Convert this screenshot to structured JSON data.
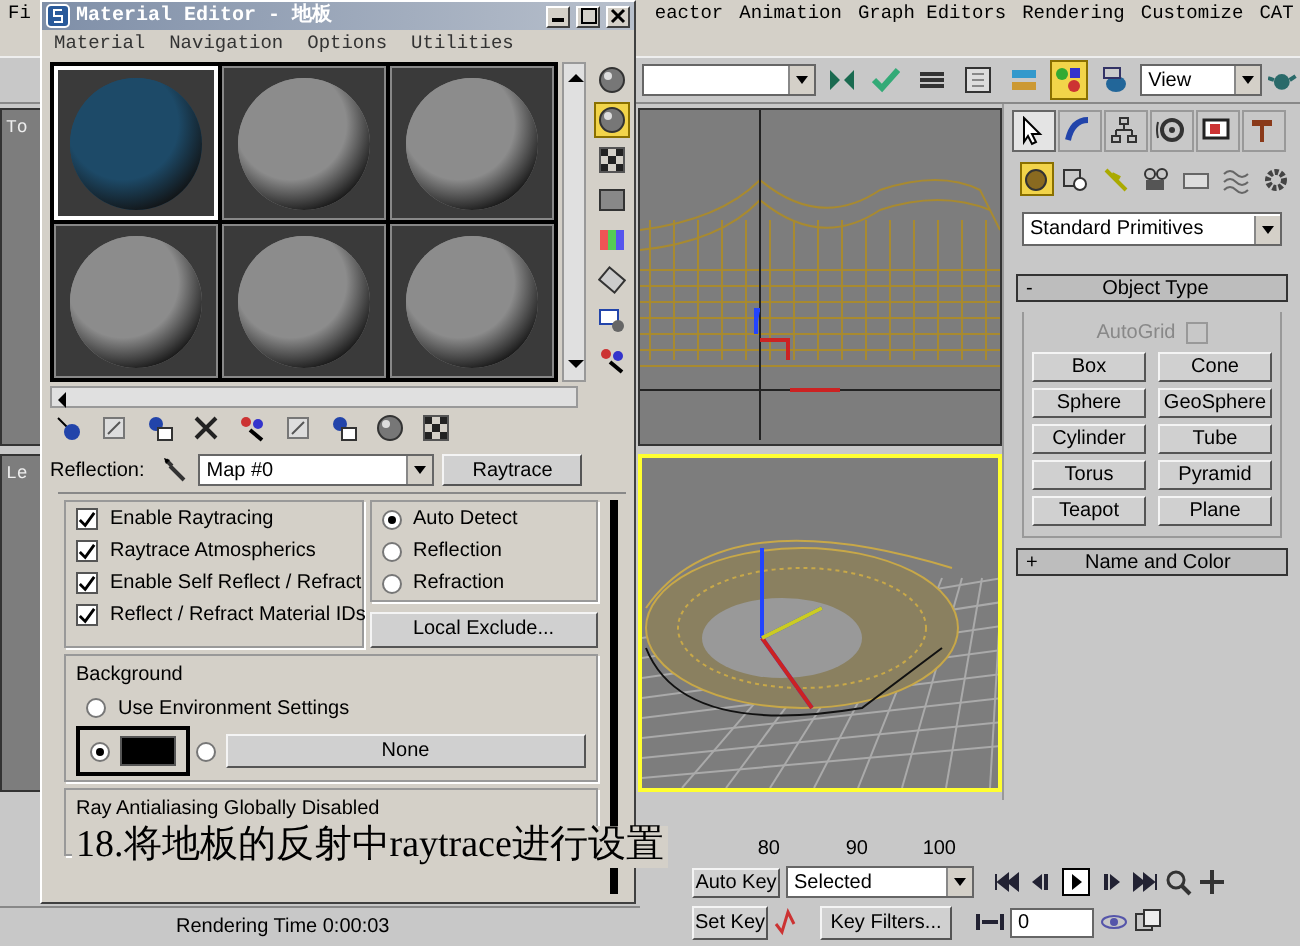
{
  "app_menu_left": [
    "Fi"
  ],
  "app_menu": [
    "eactor",
    "Animation",
    "Graph Editors",
    "Rendering",
    "Customize",
    "CAT"
  ],
  "toolbar": {
    "view_dropdown": "View",
    "tools": [
      {
        "selected": false
      },
      {
        "selected": false
      },
      {
        "selected": false
      },
      {
        "selected": false
      },
      {
        "selected": false
      },
      {
        "selected": true
      },
      {
        "selected": false
      }
    ]
  },
  "viewports": [
    {
      "label": "To",
      "active": false
    },
    {
      "active": false
    },
    {
      "label": "Le",
      "active": false
    },
    {
      "active": true
    }
  ],
  "command_panel": {
    "tabs": [
      {
        "selected": true
      },
      {
        "selected": false
      },
      {
        "selected": false
      },
      {
        "selected": false
      },
      {
        "selected": false
      },
      {
        "selected": false
      }
    ],
    "categories": [
      {
        "selected": true
      },
      {
        "selected": false
      },
      {
        "selected": false
      },
      {
        "selected": false
      },
      {
        "selected": false
      },
      {
        "selected": false
      },
      {
        "selected": false
      }
    ],
    "dropdown": "Standard Primitives",
    "rollouts": [
      {
        "sign": "-",
        "title": "Object Type",
        "autogrid": {
          "label": "AutoGrid",
          "checked": false,
          "disabled": true
        },
        "buttons": [
          "Box",
          "Cone",
          "Sphere",
          "GeoSphere",
          "Cylinder",
          "Tube",
          "Torus",
          "Pyramid",
          "Teapot",
          "Plane"
        ]
      },
      {
        "sign": "+",
        "title": "Name and Color"
      }
    ]
  },
  "timeline": {
    "ticks": [
      "80",
      "90",
      "100"
    ]
  },
  "anim_controls": {
    "auto_key": "Auto Key",
    "key_mode": "Selected",
    "set_key": "Set Key",
    "key_filters": "Key Filters...",
    "frame": "0"
  },
  "status_bar": {
    "rendering_time": "Rendering Time  0:00:03"
  },
  "material_editor": {
    "title": "Material Editor - 地板",
    "menu": [
      "Material",
      "Navigation",
      "Options",
      "Utilities"
    ],
    "slots": [
      {
        "color": "#1d4a68",
        "selected": true
      },
      {
        "color": "#8c8c8c",
        "selected": false
      },
      {
        "color": "#8c8c8c",
        "selected": false
      },
      {
        "color": "#8c8c8c",
        "selected": false
      },
      {
        "color": "#8c8c8c",
        "selected": false
      },
      {
        "color": "#8c8c8c",
        "selected": false
      }
    ],
    "side_tools": [
      {
        "selected": false
      },
      {
        "selected": true
      },
      {
        "selected": false
      },
      {
        "selected": false
      },
      {
        "selected": false
      },
      {
        "selected": false
      },
      {
        "selected": false
      },
      {
        "selected": false
      }
    ],
    "reflection": {
      "label": "Reflection:",
      "map": "Map #0",
      "button": "Raytrace"
    },
    "options": [
      {
        "label": "Enable Raytracing",
        "checked": true
      },
      {
        "label": "Raytrace Atmospherics",
        "checked": true
      },
      {
        "label": "Enable Self Reflect / Refract",
        "checked": true
      },
      {
        "label": "Reflect / Refract Material IDs",
        "checked": true
      }
    ],
    "detect": [
      {
        "label": "Auto Detect",
        "selected": true
      },
      {
        "label": "Reflection",
        "selected": false
      },
      {
        "label": "Refraction",
        "selected": false
      }
    ],
    "local_exclude": "Local Exclude...",
    "background": {
      "title": "Background",
      "choices": [
        {
          "kind": "env",
          "label": "Use Environment Settings",
          "selected": false
        },
        {
          "kind": "color",
          "color": "#000000",
          "selected": true
        },
        {
          "kind": "map",
          "label": "None",
          "selected": false
        }
      ]
    },
    "antialias": {
      "title": "Ray Antialiasing Globally Disabled"
    }
  },
  "caption": "18.将地板的反射中raytrace进行设置"
}
